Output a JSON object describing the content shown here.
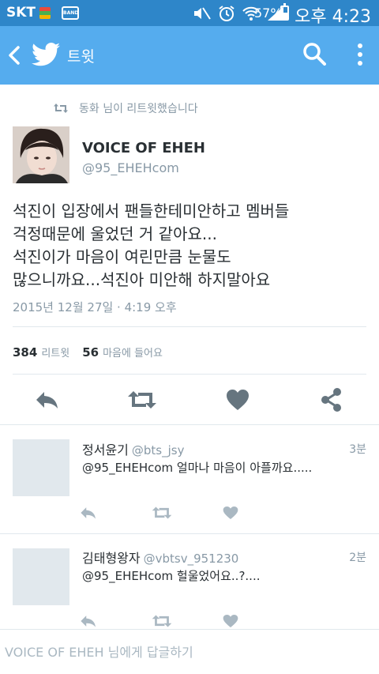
{
  "status_bar": {
    "carrier": "SKT",
    "band_label": "BAND",
    "battery_percent": "57%",
    "time": "오후 4:23"
  },
  "app_bar": {
    "title": "트윗",
    "bg_color": "#55acee"
  },
  "retweet_context": "동화 님이 리트윗했습니다",
  "tweet": {
    "author_name": "VOICE OF EHEH",
    "author_handle": "@95_EHEHcom",
    "text_lines": [
      "석진이 입장에서 팬들한테미안하고 멤버들",
      "걱정때문에 울었던 거 같아요...",
      "석진이가 마음이 여린만큼 눈물도",
      "많으니까요...석진아 미안해 하지말아요"
    ],
    "timestamp": "2015년 12월 27일 · 4:19 오후",
    "retweet_count": "384",
    "retweet_label": "리트윗",
    "like_count": "56",
    "like_label": "마음에 들어요"
  },
  "actions": [
    "reply-icon",
    "retweet-icon",
    "heart-icon",
    "share-icon"
  ],
  "replies": [
    {
      "name": "정서윤기",
      "handle": "@bts_jsy",
      "time": "3분",
      "text": "@95_EHEHcom 얼마나 마음이 아플까요....."
    },
    {
      "name": "김태형왕자",
      "handle": "@vbtsv_951230",
      "time": "2분",
      "text": "@95_EHEHcom 헐울었어요..?...."
    }
  ],
  "compose": {
    "placeholder": "VOICE OF EHEH 님에게 답글하기"
  }
}
